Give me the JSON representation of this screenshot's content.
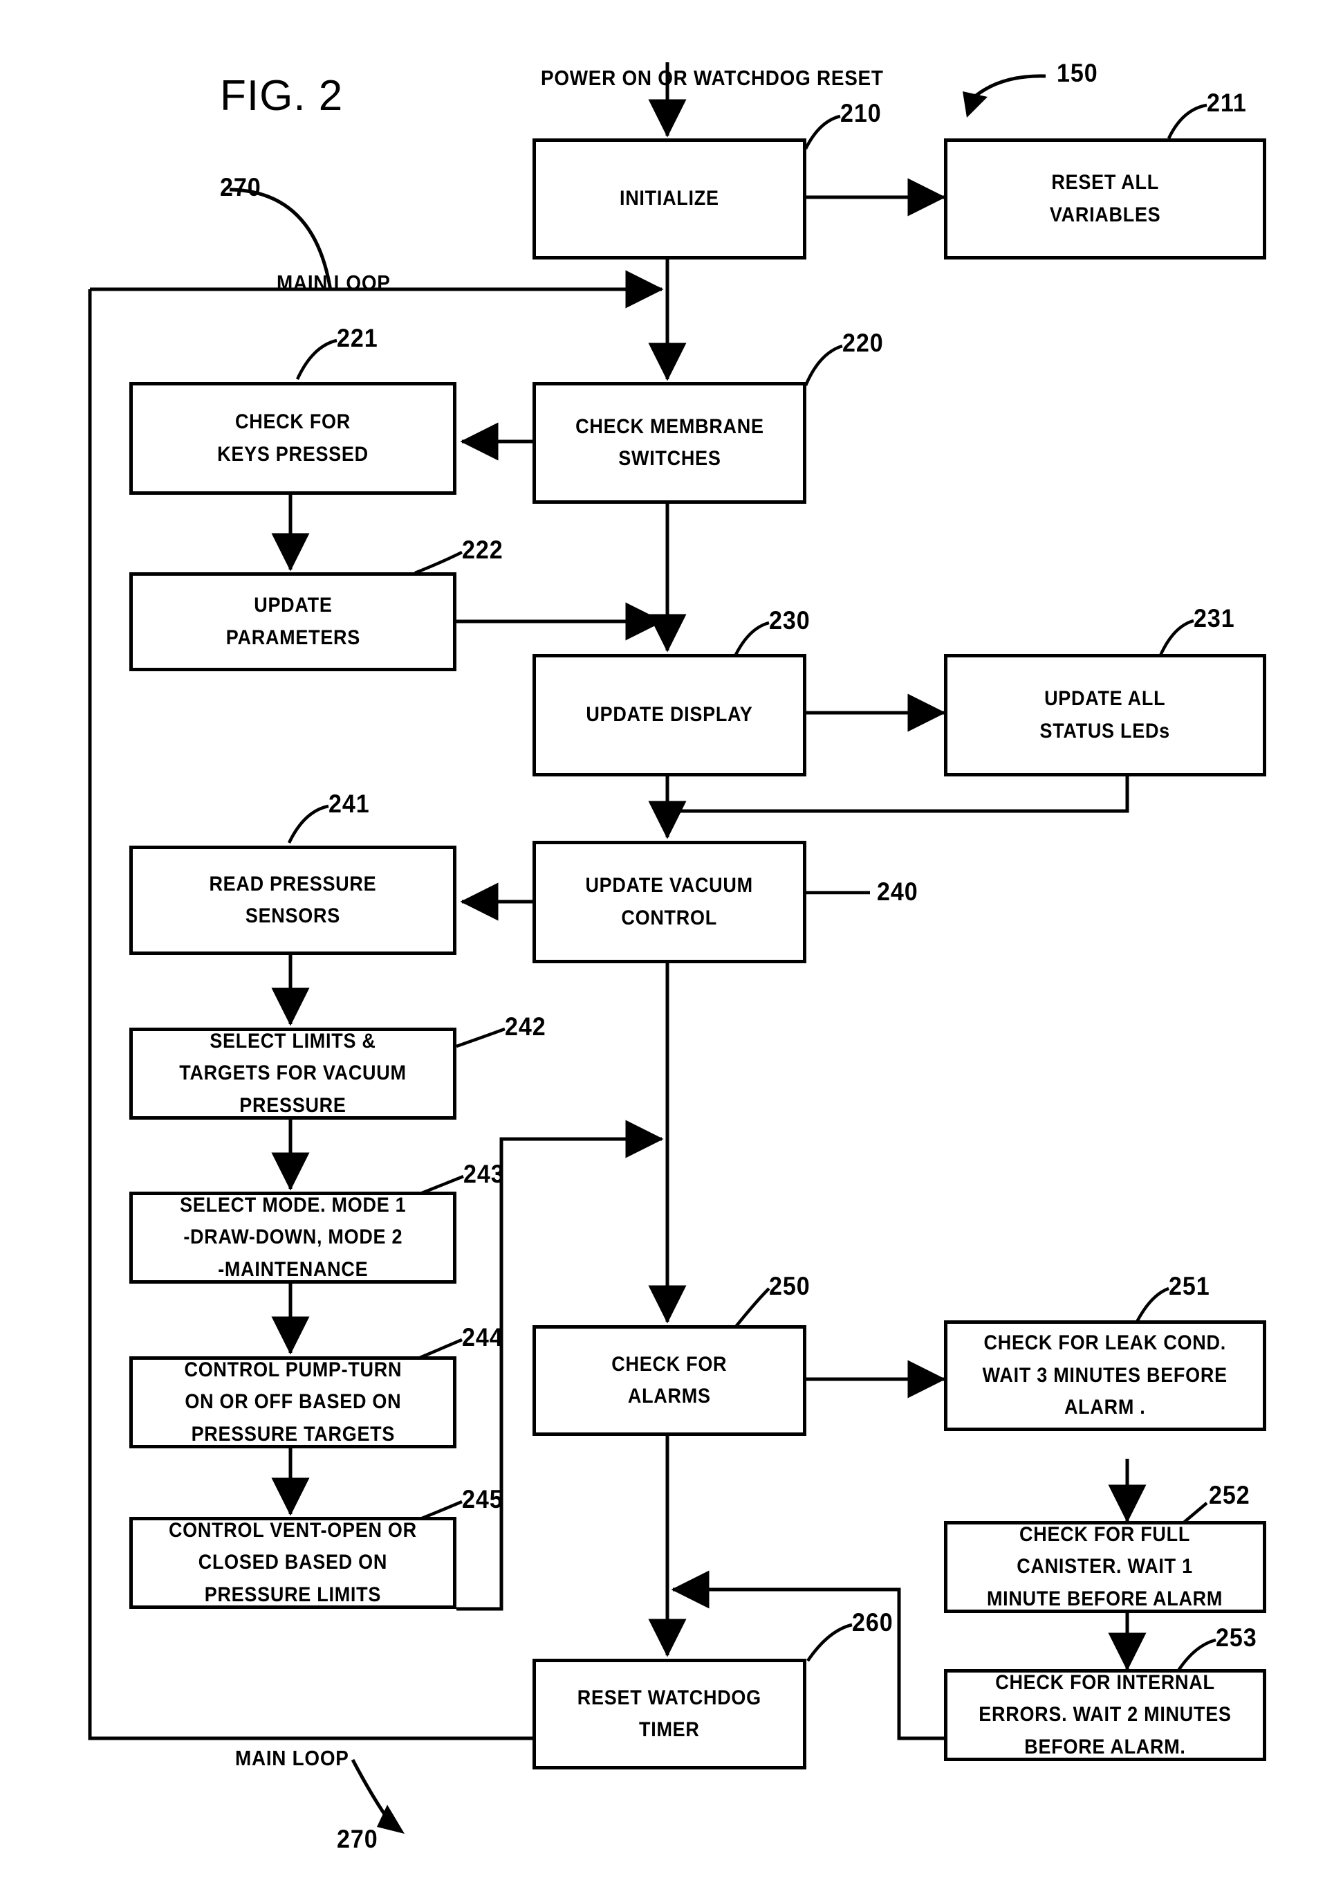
{
  "figure": {
    "label": "FIG. 2"
  },
  "captions": {
    "power_on": "POWER ON OR WATCHDOG RESET",
    "main_loop_top": "MAIN LOOP",
    "main_loop_bottom": "MAIN LOOP"
  },
  "ref_numbers": {
    "system": "150",
    "initialize": "210",
    "reset_all_variables": "211",
    "check_membrane_switches": "220",
    "check_for_keys_pressed": "221",
    "update_parameters": "222",
    "update_display": "230",
    "update_all_status_leds": "231",
    "update_vacuum_control": "240",
    "read_pressure_sensors": "241",
    "select_limits_targets": "242",
    "select_mode": "243",
    "control_pump": "244",
    "control_vent": "245",
    "check_for_alarms": "250",
    "check_leak_cond": "251",
    "check_full_canister": "252",
    "check_internal_errors": "253",
    "reset_watchdog_timer": "260",
    "main_loop_top": "270",
    "main_loop_bottom": "270"
  },
  "boxes": {
    "initialize": {
      "lines": [
        "INITIALIZE"
      ]
    },
    "reset_all_variables": {
      "lines": [
        "RESET ALL",
        "VARIABLES"
      ]
    },
    "check_for_keys_pressed": {
      "lines": [
        "CHECK FOR",
        "KEYS PRESSED"
      ]
    },
    "check_membrane_switches": {
      "lines": [
        "CHECK MEMBRANE",
        "SWITCHES"
      ]
    },
    "update_parameters": {
      "lines": [
        "UPDATE",
        "PARAMETERS"
      ]
    },
    "update_display": {
      "lines": [
        "UPDATE DISPLAY"
      ]
    },
    "update_all_status_leds": {
      "lines": [
        "UPDATE ALL",
        "STATUS LEDs"
      ]
    },
    "read_pressure_sensors": {
      "lines": [
        "READ PRESSURE",
        "SENSORS"
      ]
    },
    "update_vacuum_control": {
      "lines": [
        "UPDATE VACUUM",
        "CONTROL"
      ]
    },
    "select_limits_targets": {
      "lines": [
        "SELECT LIMITS &",
        "TARGETS FOR VACUUM",
        "PRESSURE"
      ]
    },
    "select_mode": {
      "lines": [
        "SELECT MODE. MODE 1",
        "-DRAW-DOWN, MODE 2",
        "-MAINTENANCE"
      ]
    },
    "control_pump": {
      "lines": [
        "CONTROL PUMP-TURN",
        "ON OR OFF BASED ON",
        "PRESSURE TARGETS"
      ]
    },
    "control_vent": {
      "lines": [
        "CONTROL VENT-OPEN OR",
        "CLOSED BASED ON",
        "PRESSURE LIMITS"
      ]
    },
    "check_for_alarms": {
      "lines": [
        "CHECK FOR",
        "ALARMS"
      ]
    },
    "check_leak_cond": {
      "lines": [
        "CHECK FOR LEAK COND.",
        "WAIT 3 MINUTES BEFORE",
        "ALARM ."
      ]
    },
    "check_full_canister": {
      "lines": [
        "CHECK FOR FULL",
        "CANISTER. WAIT 1",
        "MINUTE BEFORE ALARM"
      ]
    },
    "check_internal_errors": {
      "lines": [
        "CHECK FOR INTERNAL",
        "ERRORS. WAIT 2 MINUTES",
        "BEFORE ALARM."
      ]
    },
    "reset_watchdog_timer": {
      "lines": [
        "RESET WATCHDOG",
        "TIMER"
      ]
    }
  },
  "colors": {
    "ink": "#000000",
    "paper": "#ffffff"
  }
}
